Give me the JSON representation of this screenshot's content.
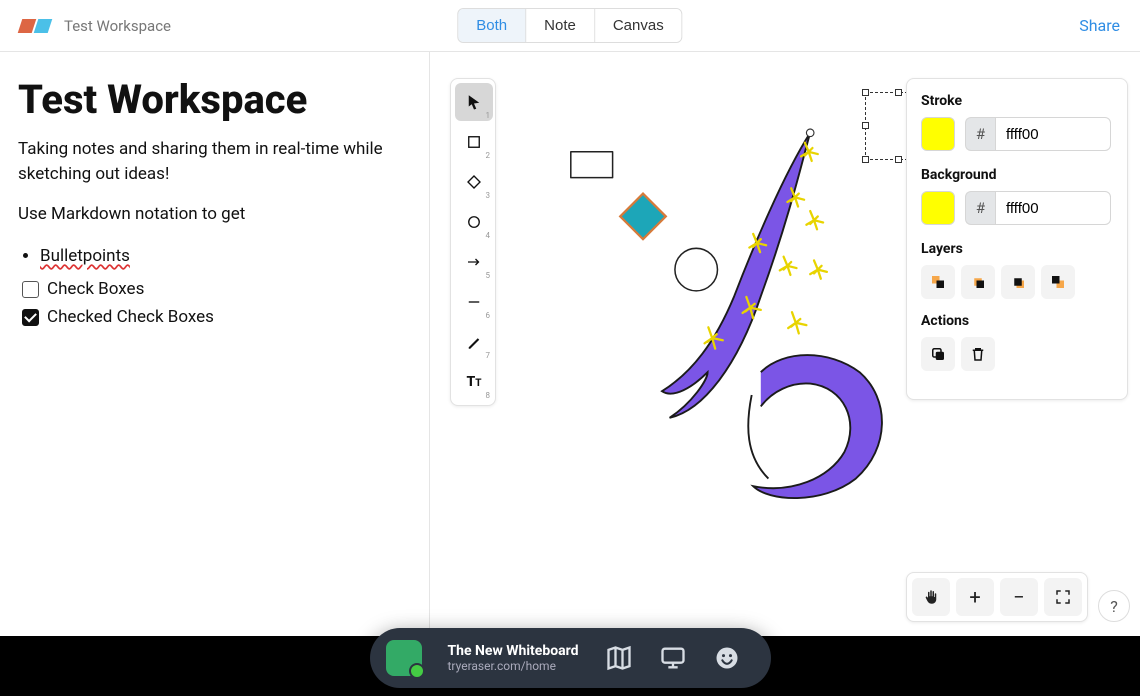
{
  "header": {
    "workspace_name": "Test Workspace",
    "tabs": [
      {
        "label": "Both",
        "active": true
      },
      {
        "label": "Note",
        "active": false
      },
      {
        "label": "Canvas",
        "active": false
      }
    ],
    "share_label": "Share"
  },
  "note": {
    "title": "Test Workspace",
    "body": "Taking notes and sharing them in real-time while sketching out ideas!",
    "intro_line": "Use Markdown notation to get",
    "bullet": "Bulletpoints",
    "checkbox1_label": "Check Boxes",
    "checkbox2_label": "Checked Check Boxes"
  },
  "tools": [
    {
      "name": "select",
      "hotkey": "1",
      "selected": true
    },
    {
      "name": "rectangle",
      "hotkey": "2",
      "selected": false
    },
    {
      "name": "diamond",
      "hotkey": "3",
      "selected": false
    },
    {
      "name": "ellipse",
      "hotkey": "4",
      "selected": false
    },
    {
      "name": "arrow",
      "hotkey": "5",
      "selected": false
    },
    {
      "name": "line",
      "hotkey": "6",
      "selected": false
    },
    {
      "name": "draw",
      "hotkey": "7",
      "selected": false
    },
    {
      "name": "text",
      "hotkey": "8",
      "selected": false
    }
  ],
  "props": {
    "stroke_label": "Stroke",
    "stroke_swatch": "#ffff00",
    "stroke_hex": "ffff00",
    "bg_label": "Background",
    "bg_swatch": "#ffff00",
    "bg_hex": "ffff00",
    "layers_label": "Layers",
    "actions_label": "Actions",
    "hash": "#"
  },
  "viewport_controls": {
    "pan": "✋",
    "zoom_in": "+",
    "zoom_out": "−",
    "fullscreen": "⛶",
    "help": "?"
  },
  "dock": {
    "title": "The New Whiteboard",
    "subtitle": "tryeraser.com/home"
  }
}
